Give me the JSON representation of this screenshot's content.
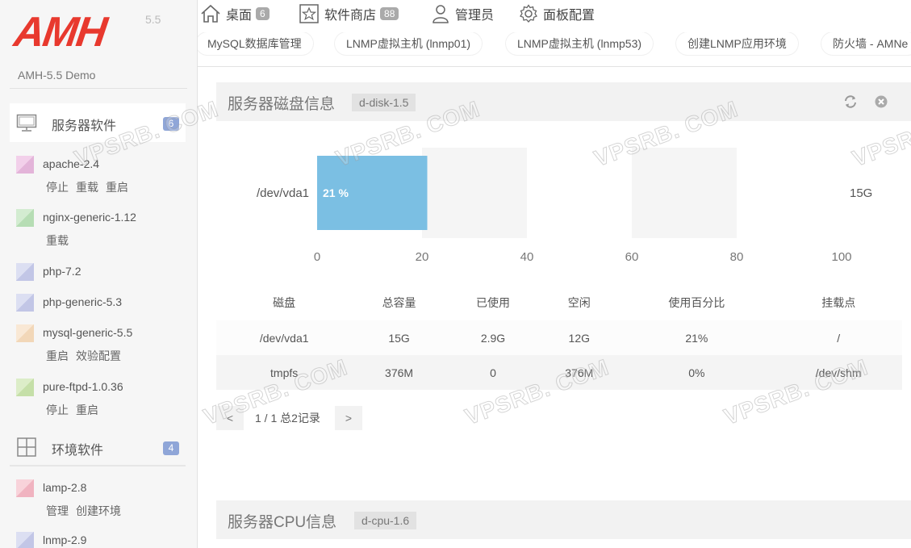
{
  "logo": {
    "text": "AMH",
    "version": "5.5"
  },
  "demo_title": "AMH-5.5 Demo",
  "nav": {
    "items": [
      {
        "label": "桌面",
        "badge": "6"
      },
      {
        "label": "软件商店",
        "badge": "88"
      },
      {
        "label": "管理员"
      },
      {
        "label": "面板配置"
      }
    ]
  },
  "quicklinks": [
    "MySQL数据库管理",
    "LNMP虚拟主机 (lnmp01)",
    "LNMP虚拟主机 (lnmp53)",
    "创建LNMP应用环境",
    "防火墙 - AMNe"
  ],
  "sidebar": {
    "server_software": {
      "label": "服务器软件",
      "count": "6"
    },
    "env_software": {
      "label": "环境软件",
      "count": "4"
    },
    "items": [
      {
        "name": "apache-2.4",
        "actions": [
          "停止",
          "重载",
          "重启"
        ],
        "color": "#e3b4d9"
      },
      {
        "name": "nginx-generic-1.12",
        "actions": [
          "重载"
        ],
        "color": "#b6ddb4"
      },
      {
        "name": "php-7.2",
        "actions": [],
        "color": "#c2c6e6"
      },
      {
        "name": "php-generic-5.3",
        "actions": [],
        "color": "#c2c6e6"
      },
      {
        "name": "mysql-generic-5.5",
        "actions": [
          "重启",
          "效验配置"
        ],
        "color": "#f2d7b8"
      },
      {
        "name": "pure-ftpd-1.0.36",
        "actions": [
          "停止",
          "重启"
        ],
        "color": "#c5dfa8"
      }
    ],
    "env_items": [
      {
        "name": "lamp-2.8",
        "actions": [
          "管理",
          "创建环境"
        ],
        "color": "#f0b3c0"
      },
      {
        "name": "lnmp-2.9",
        "actions": [],
        "color": "#c2c6e6"
      }
    ]
  },
  "disk_panel": {
    "title": "服务器磁盘信息",
    "tag": "d-disk-1.5"
  },
  "cpu_panel": {
    "title": "服务器CPU信息",
    "tag": "d-cpu-1.6"
  },
  "chart_data": {
    "type": "bar",
    "orientation": "horizontal",
    "categories": [
      "/dev/vda1"
    ],
    "values": [
      21
    ],
    "value_labels": [
      "21 %"
    ],
    "right_labels": [
      "15G"
    ],
    "xlim": [
      0,
      100
    ],
    "xticks": [
      "0",
      "20",
      "40",
      "60",
      "80",
      "100"
    ],
    "bar_color": "#7bbfe3"
  },
  "disk_table": {
    "headers": [
      "磁盘",
      "总容量",
      "已使用",
      "空闲",
      "使用百分比",
      "挂载点"
    ],
    "rows": [
      [
        "/dev/vda1",
        "15G",
        "2.9G",
        "12G",
        "21%",
        "/"
      ],
      [
        "tmpfs",
        "376M",
        "0",
        "376M",
        "0%",
        "/dev/shm"
      ]
    ]
  },
  "pager": {
    "prev": "<",
    "info": "1 / 1 总2记录",
    "next": ">"
  },
  "watermark": "VPSRB. COM"
}
